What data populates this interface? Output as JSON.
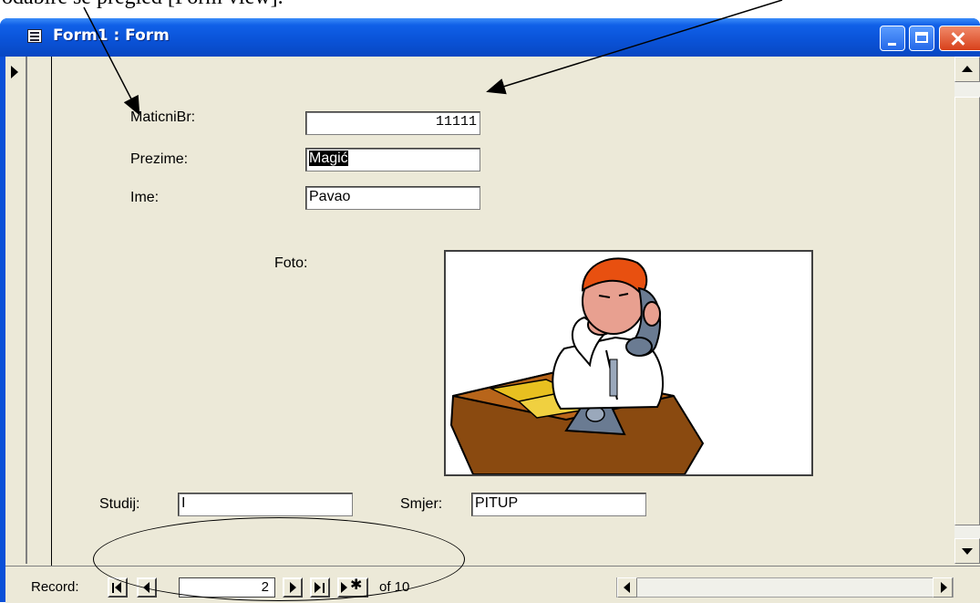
{
  "doc": {
    "text": "odabire se pregled [Form view]."
  },
  "window": {
    "title": "Form1 : Form"
  },
  "form": {
    "maticni_label": "MaticniBr:",
    "maticni_value": "11111",
    "prezime_label": "Prezime:",
    "prezime_value": "Magić",
    "ime_label": "Ime:",
    "ime_value": "Pavao",
    "foto_label": "Foto:",
    "studij_label": "Studij:",
    "studij_value": "I",
    "smjer_label": "Smjer:",
    "smjer_value": "PITUP"
  },
  "nav": {
    "record_label": "Record:",
    "current_record": "2",
    "total_text": "of  10"
  },
  "colors": {
    "titlebar": "#0a52d6",
    "client": "#ece9d8",
    "close_button": "#d8401a"
  }
}
